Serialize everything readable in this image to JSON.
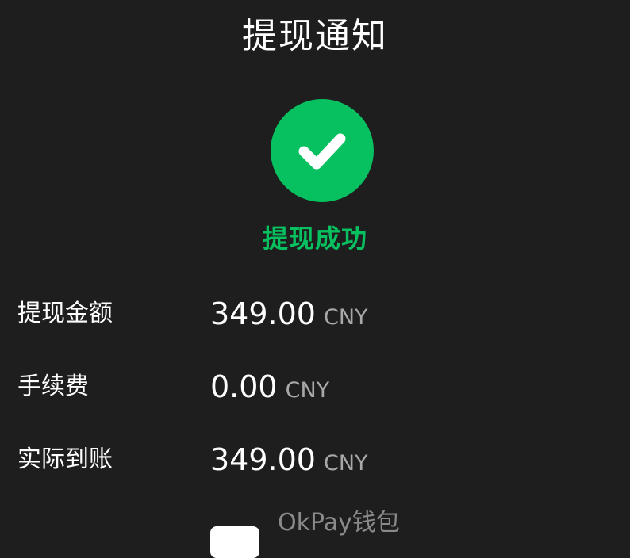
{
  "header": {
    "title": "提现通知"
  },
  "status": {
    "icon": "check-circle-icon",
    "text": "提现成功",
    "color": "#07c160"
  },
  "details": [
    {
      "label": "提现金额",
      "amount": "349.00",
      "currency": "CNY"
    },
    {
      "label": "手续费",
      "amount": "0.00",
      "currency": "CNY"
    },
    {
      "label": "实际到账",
      "amount": "349.00",
      "currency": "CNY"
    }
  ],
  "wallet": {
    "name": "OkPay钱包",
    "logo_icon": "wallet-logo-icon"
  }
}
